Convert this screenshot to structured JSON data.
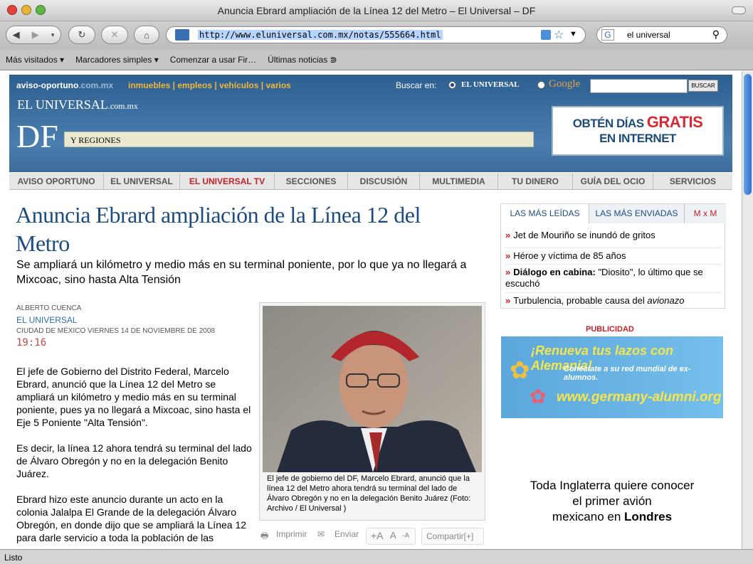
{
  "window": {
    "title": "Anuncia Ebrard ampliación de la Línea 12 del Metro – El Universal – DF",
    "url": "http://www.eluniversal.com.mx/notas/555664.html",
    "search_value": "el universal"
  },
  "bookmarks": [
    "Más visitados ▾",
    "Marcadores simples ▾",
    "Comenzar a usar Fir…",
    "Últimas noticias ⋑"
  ],
  "status": "Listo",
  "masthead": {
    "aviso": "aviso-oportuno",
    "aviso_domain": ".com.mx",
    "aviso_links": "inmuebles | empleos | vehículos | varios",
    "buscar_label": "Buscar en:",
    "option_universal": "EL UNIVERSAL",
    "option_google": "Google",
    "buscar_button": "BUSCAR",
    "brand": "EL UNIVERSAL",
    "brand_domain": ".com.mx",
    "section": "DF",
    "region": "Y REGIONES",
    "promo_line1": "OBTÉN DÍAS",
    "promo_gratis": "GRATIS",
    "promo_line2": "EN INTERNET"
  },
  "nav": [
    "AVISO OPORTUNO",
    "EL UNIVERSAL",
    "EL UNIVERSAL TV",
    "SECCIONES",
    "DISCUSIÓN",
    "MULTIMEDIA",
    "TU DINERO",
    "GUÍA DEL OCIO",
    "SERVICIOS"
  ],
  "article": {
    "headline": "Anuncia Ebrard ampliación de la Línea 12 del Metro",
    "subhead": "Se ampliará un kilómetro y medio más en su terminal poniente, por lo que ya no llegará a Mixcoac, sino hasta Alta Tensión",
    "author": "ALBERTO CUENCA",
    "publication": "EL UNIVERSAL",
    "dateline": "CIUDAD DE MÉXICO VIERNES 14 DE NOVIEMBRE DE 2008",
    "time": "19:16",
    "p1": "El jefe de Gobierno del Distrito Federal, Marcelo Ebrard, anunció que la Línea 12 del Metro se ampliará un kilómetro y medio más en su terminal poniente, pues ya no llegará a Mixcoac, sino hasta el Eje 5 Poniente \"Alta Tensión\".",
    "p2": "Es decir, la línea 12 ahora tendrá su terminal del lado de Álvaro Obregón y no en la delegación Benito Juárez.",
    "p3": "Ebrard hizo este anuncio durante un acto en la colonia Jalalpa El Grande de la delegación Álvaro Obregón, en donde dijo que se ampliará la Línea 12 para darle servicio a toda la población de las",
    "caption": "El jefe de gobierno del DF, Marcelo Ebrard, anunció que la línea 12 del Metro ahora tendrá su terminal del lado de Álvaro Obregón y no en la delegación Benito Juárez (Foto: Archivo / El Universal )"
  },
  "tools": {
    "print": "Imprimir",
    "send": "Enviar",
    "font_large": "+A",
    "font_mid": "A",
    "font_small": "-A",
    "share": "Compartir[+]"
  },
  "sidebar": {
    "tabs": [
      "LAS MÁS LEÍDAS",
      "LAS MÁS ENVIADAS",
      "M x M"
    ],
    "items": [
      {
        "bold": "",
        "text": "Jet de Mouriño se inundó de gritos"
      },
      {
        "bold": "",
        "text": "Héroe y víctima de 85 años"
      },
      {
        "bold": "Diálogo en cabina:",
        "text": "\"Diosito\", lo último que se escuchó"
      },
      {
        "bold": "",
        "text": "Turbulencia, probable causa del",
        "italic": "avionazo"
      }
    ],
    "publicidad": "PUBLICIDAD",
    "ad1": {
      "line1": "¡Renueva tus lazos con Alemania!",
      "line2": "Conéctate a su red mundial de ex-alumnos.",
      "line3": "www.germany-alumni.org"
    },
    "ad2": {
      "line1": "Toda Inglaterra quiere conocer",
      "line2": "el primer avión",
      "line3": "mexicano en",
      "bold": "Londres"
    }
  }
}
